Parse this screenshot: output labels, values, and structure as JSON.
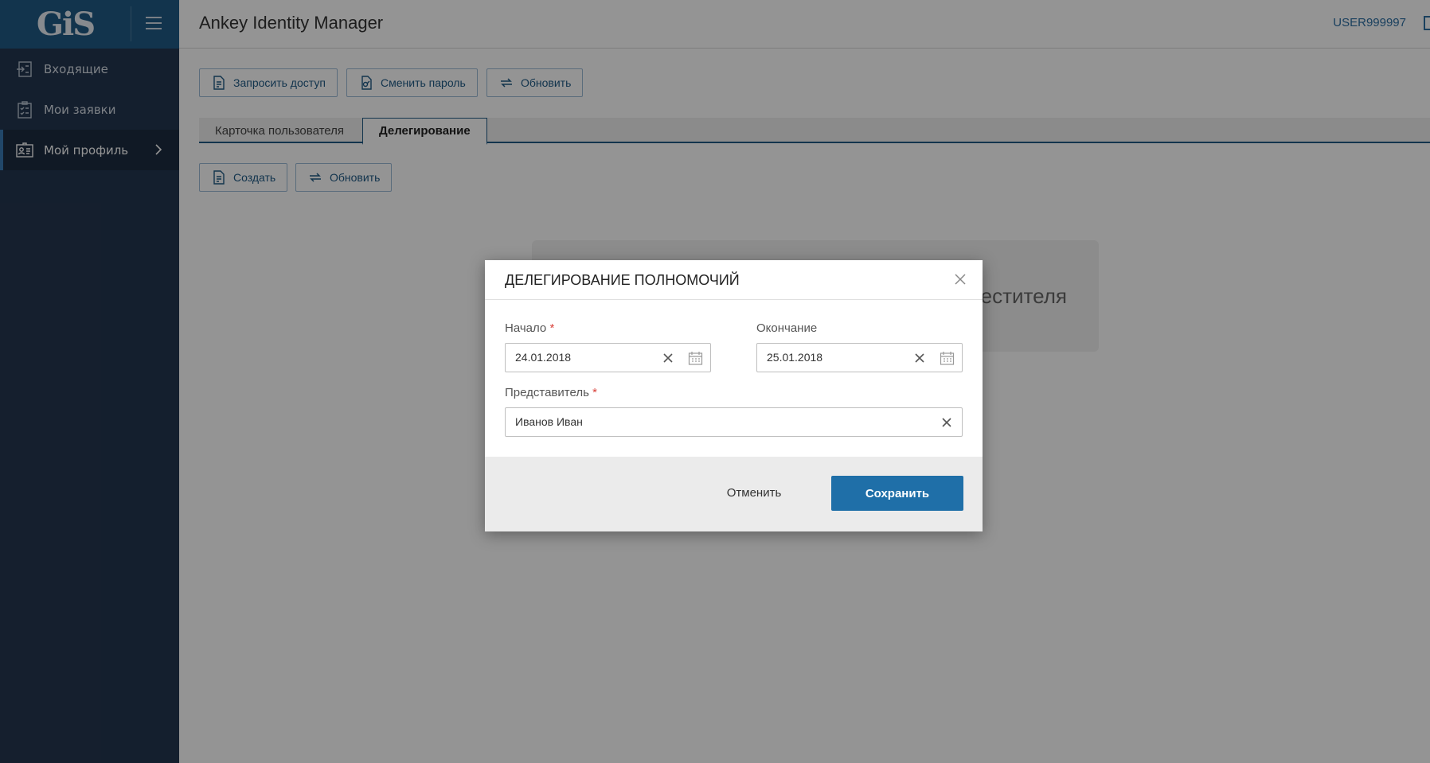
{
  "sidebar": {
    "logo_text": "GiS",
    "items": [
      {
        "label": "Входящие",
        "icon": "inbox-icon"
      },
      {
        "label": "Мои заявки",
        "icon": "checklist-icon"
      },
      {
        "label": "Мой профиль",
        "icon": "id-card-icon"
      }
    ]
  },
  "header": {
    "title": "Ankey Identity Manager",
    "user": "USER999997"
  },
  "toolbar": {
    "request_access": "Запросить доступ",
    "change_password": "Сменить пароль",
    "refresh": "Обновить"
  },
  "tabs": [
    {
      "label": "Карточка пользователя"
    },
    {
      "label": "Делегирование"
    }
  ],
  "subtoolbar": {
    "create": "Создать",
    "refresh": "Обновить"
  },
  "background_card": {
    "text": "естителя"
  },
  "modal": {
    "title": "ДЕЛЕГИРОВАНИЕ ПОЛНОМОЧИЙ",
    "start_label": "Начало",
    "start_value": "24.01.2018",
    "end_label": "Окончание",
    "end_value": "25.01.2018",
    "delegate_label": "Представитель",
    "delegate_value": "Иванов Иван",
    "required_mark": "*",
    "cancel": "Отменить",
    "save": "Сохранить"
  },
  "colors": {
    "sidebar_bg": "#243650",
    "logo_bg": "#1f5a86",
    "accent": "#1f6fa8",
    "required": "#d9433c"
  }
}
